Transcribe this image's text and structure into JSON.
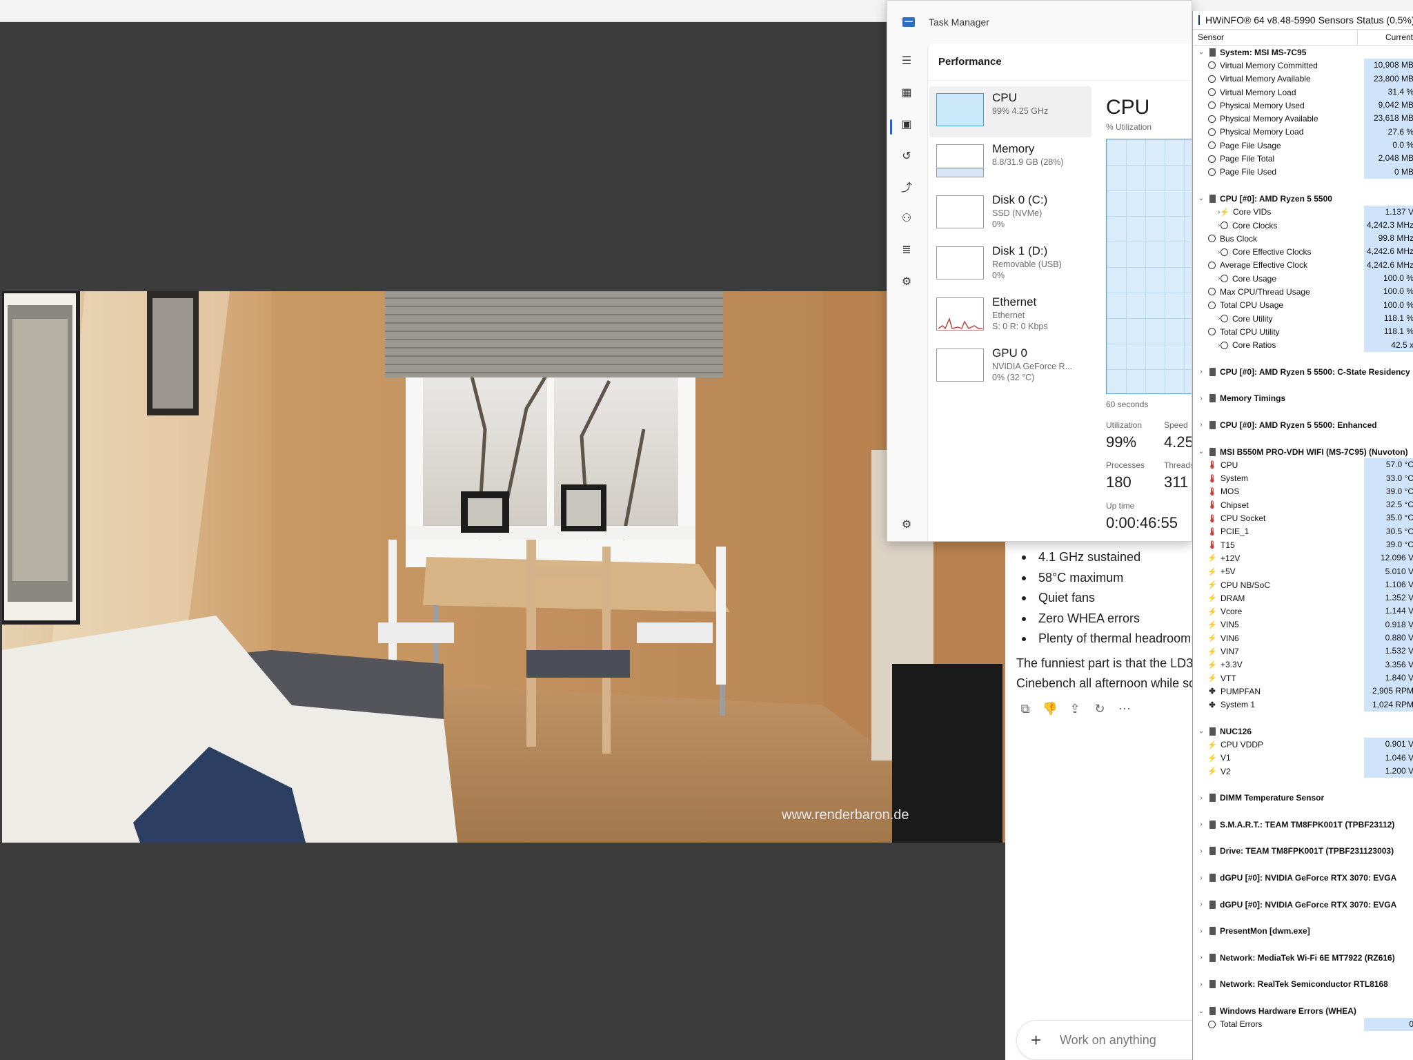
{
  "chat": {
    "bullets": [
      "4.1 GHz sustained",
      "58°C maximum",
      "Quiet fans",
      "Zero WHEA errors",
      "Plenty of thermal headroom"
    ],
    "paragraph_line1": "The funniest part is that the LD3",
    "paragraph_line2": "Cinebench all afternoon while sc",
    "composer_placeholder": "Work on anything"
  },
  "viewer": {
    "watermark": "www.renderbaron.de"
  },
  "task_manager": {
    "title": "Task Manager",
    "header": "Performance",
    "devices": [
      {
        "name": "CPU",
        "sub1": "99% 4.25 GHz",
        "sub2": "",
        "sub3": ""
      },
      {
        "name": "Memory",
        "sub1": "8.8/31.9 GB (28%)",
        "sub2": "",
        "sub3": ""
      },
      {
        "name": "Disk 0 (C:)",
        "sub1": "SSD (NVMe)",
        "sub2": "0%",
        "sub3": ""
      },
      {
        "name": "Disk 1 (D:)",
        "sub1": "Removable (USB)",
        "sub2": "0%",
        "sub3": ""
      },
      {
        "name": "Ethernet",
        "sub1": "Ethernet",
        "sub2": "S: 0 R: 0 Kbps",
        "sub3": ""
      },
      {
        "name": "GPU 0",
        "sub1": "NVIDIA GeForce R...",
        "sub2": "0% (32 °C)",
        "sub3": ""
      }
    ],
    "detail": {
      "title": "CPU",
      "subtitle": "% Utilization",
      "graph_span": "60 seconds",
      "utilization_label": "Utilization",
      "utilization_value": "99%",
      "speed_label": "Speed",
      "speed_value": "4.25",
      "processes_label": "Processes",
      "processes_value": "180",
      "threads_label": "Threads",
      "threads_value": "311",
      "uptime_label": "Up time",
      "uptime_value": "0:00:46:55"
    },
    "rail_icons": [
      "hamburger-icon",
      "processes-icon",
      "performance-icon",
      "app-history-icon",
      "startup-icon",
      "users-icon",
      "details-icon",
      "services-icon",
      "settings-icon"
    ]
  },
  "hwinfo": {
    "title": "HWiNFO® 64 v8.48-5990 Sensors Status (0.5%)",
    "col_sensor": "Sensor",
    "col_current": "Current",
    "rows": [
      {
        "t": "group",
        "caret": "v",
        "icon": "chip",
        "name": "System: MSI MS-7C95",
        "val": ""
      },
      {
        "t": "item",
        "caret": "",
        "icon": "clock",
        "name": "Virtual Memory Committed",
        "val": "10,908 MB"
      },
      {
        "t": "item",
        "caret": "",
        "icon": "clock",
        "name": "Virtual Memory Available",
        "val": "23,800 MB"
      },
      {
        "t": "item",
        "caret": "",
        "icon": "clock",
        "name": "Virtual Memory Load",
        "val": "31.4 %"
      },
      {
        "t": "item",
        "caret": "",
        "icon": "clock",
        "name": "Physical Memory Used",
        "val": "9,042 MB"
      },
      {
        "t": "item",
        "caret": "",
        "icon": "clock",
        "name": "Physical Memory Available",
        "val": "23,618 MB"
      },
      {
        "t": "item",
        "caret": "",
        "icon": "clock",
        "name": "Physical Memory Load",
        "val": "27.6 %"
      },
      {
        "t": "item",
        "caret": "",
        "icon": "clock",
        "name": "Page File Usage",
        "val": "0.0 %"
      },
      {
        "t": "item",
        "caret": "",
        "icon": "clock",
        "name": "Page File Total",
        "val": "2,048 MB"
      },
      {
        "t": "item",
        "caret": "",
        "icon": "clock",
        "name": "Page File Used",
        "val": "0 MB"
      },
      {
        "t": "spacer",
        "caret": "",
        "icon": "",
        "name": "",
        "val": ""
      },
      {
        "t": "group",
        "caret": "v",
        "icon": "chip",
        "name": "CPU [#0]: AMD Ryzen 5 5500",
        "val": ""
      },
      {
        "t": "child",
        "caret": ">",
        "icon": "volt",
        "name": "Core VIDs",
        "val": "1.137 V"
      },
      {
        "t": "child",
        "caret": ">",
        "icon": "clock",
        "name": "Core Clocks",
        "val": "4,242.3 MHz"
      },
      {
        "t": "item",
        "caret": "",
        "icon": "clock",
        "name": "Bus Clock",
        "val": "99.8 MHz"
      },
      {
        "t": "child",
        "caret": ">",
        "icon": "clock",
        "name": "Core Effective Clocks",
        "val": "4,242.6 MHz"
      },
      {
        "t": "item",
        "caret": "",
        "icon": "clock",
        "name": "Average Effective Clock",
        "val": "4,242.6 MHz"
      },
      {
        "t": "child",
        "caret": ">",
        "icon": "clock",
        "name": "Core Usage",
        "val": "100.0 %"
      },
      {
        "t": "item",
        "caret": "",
        "icon": "clock",
        "name": "Max CPU/Thread Usage",
        "val": "100.0 %"
      },
      {
        "t": "item",
        "caret": "",
        "icon": "clock",
        "name": "Total CPU Usage",
        "val": "100.0 %"
      },
      {
        "t": "child",
        "caret": ">",
        "icon": "clock",
        "name": "Core Utility",
        "val": "118.1 %"
      },
      {
        "t": "item",
        "caret": "",
        "icon": "clock",
        "name": "Total CPU Utility",
        "val": "118.1 %"
      },
      {
        "t": "child",
        "caret": ">",
        "icon": "clock",
        "name": "Core Ratios",
        "val": "42.5 x"
      },
      {
        "t": "spacer",
        "caret": "",
        "icon": "",
        "name": "",
        "val": ""
      },
      {
        "t": "group",
        "caret": ">",
        "icon": "chip",
        "name": "CPU [#0]: AMD Ryzen 5 5500: C-State Residency",
        "val": ""
      },
      {
        "t": "spacer",
        "caret": "",
        "icon": "",
        "name": "",
        "val": ""
      },
      {
        "t": "group",
        "caret": ">",
        "icon": "chip",
        "name": "Memory Timings",
        "val": ""
      },
      {
        "t": "spacer",
        "caret": "",
        "icon": "",
        "name": "",
        "val": ""
      },
      {
        "t": "group",
        "caret": ">",
        "icon": "chip",
        "name": "CPU [#0]: AMD Ryzen 5 5500: Enhanced",
        "val": ""
      },
      {
        "t": "spacer",
        "caret": "",
        "icon": "",
        "name": "",
        "val": ""
      },
      {
        "t": "group",
        "caret": "v",
        "icon": "chip",
        "name": "MSI B550M PRO-VDH WIFI (MS-7C95) (Nuvoton)",
        "val": ""
      },
      {
        "t": "item",
        "caret": "",
        "icon": "temp",
        "name": "CPU",
        "val": "57.0 °C"
      },
      {
        "t": "item",
        "caret": "",
        "icon": "temp",
        "name": "System",
        "val": "33.0 °C"
      },
      {
        "t": "item",
        "caret": "",
        "icon": "temp",
        "name": "MOS",
        "val": "39.0 °C"
      },
      {
        "t": "item",
        "caret": "",
        "icon": "temp",
        "name": "Chipset",
        "val": "32.5 °C"
      },
      {
        "t": "item",
        "caret": "",
        "icon": "temp",
        "name": "CPU Socket",
        "val": "35.0 °C"
      },
      {
        "t": "item",
        "caret": "",
        "icon": "temp",
        "name": "PCIE_1",
        "val": "30.5 °C"
      },
      {
        "t": "item",
        "caret": "",
        "icon": "temp",
        "name": "T15",
        "val": "39.0 °C"
      },
      {
        "t": "item",
        "caret": "",
        "icon": "volt",
        "name": "+12V",
        "val": "12.096 V"
      },
      {
        "t": "item",
        "caret": "",
        "icon": "volt",
        "name": "+5V",
        "val": "5.010 V"
      },
      {
        "t": "item",
        "caret": "",
        "icon": "volt",
        "name": "CPU NB/SoC",
        "val": "1.106 V"
      },
      {
        "t": "item",
        "caret": "",
        "icon": "volt",
        "name": "DRAM",
        "val": "1.352 V"
      },
      {
        "t": "item",
        "caret": "",
        "icon": "volt",
        "name": "Vcore",
        "val": "1.144 V"
      },
      {
        "t": "item",
        "caret": "",
        "icon": "volt",
        "name": "VIN5",
        "val": "0.918 V"
      },
      {
        "t": "item",
        "caret": "",
        "icon": "volt",
        "name": "VIN6",
        "val": "0.880 V"
      },
      {
        "t": "item",
        "caret": "",
        "icon": "volt",
        "name": "VIN7",
        "val": "1.532 V"
      },
      {
        "t": "item",
        "caret": "",
        "icon": "volt",
        "name": "+3.3V",
        "val": "3.356 V"
      },
      {
        "t": "item",
        "caret": "",
        "icon": "volt",
        "name": "VTT",
        "val": "1.840 V"
      },
      {
        "t": "item",
        "caret": "",
        "icon": "fan",
        "name": "PUMPFAN",
        "val": "2,905 RPM"
      },
      {
        "t": "item",
        "caret": "",
        "icon": "fan",
        "name": "System 1",
        "val": "1,024 RPM"
      },
      {
        "t": "spacer",
        "caret": "",
        "icon": "",
        "name": "",
        "val": ""
      },
      {
        "t": "group",
        "caret": "v",
        "icon": "chip",
        "name": "NUC126",
        "val": ""
      },
      {
        "t": "item",
        "caret": "",
        "icon": "volt",
        "name": "CPU VDDP",
        "val": "0.901 V"
      },
      {
        "t": "item",
        "caret": "",
        "icon": "volt",
        "name": "V1",
        "val": "1.046 V"
      },
      {
        "t": "item",
        "caret": "",
        "icon": "volt",
        "name": "V2",
        "val": "1.200 V"
      },
      {
        "t": "spacer",
        "caret": "",
        "icon": "",
        "name": "",
        "val": ""
      },
      {
        "t": "group",
        "caret": ">",
        "icon": "chip",
        "name": "DIMM Temperature Sensor",
        "val": ""
      },
      {
        "t": "spacer",
        "caret": "",
        "icon": "",
        "name": "",
        "val": ""
      },
      {
        "t": "group",
        "caret": ">",
        "icon": "chip",
        "name": "S.M.A.R.T.: TEAM TM8FPK001T (TPBF23112)",
        "val": ""
      },
      {
        "t": "spacer",
        "caret": "",
        "icon": "",
        "name": "",
        "val": ""
      },
      {
        "t": "group",
        "caret": ">",
        "icon": "chip",
        "name": "Drive: TEAM TM8FPK001T (TPBF231123003)",
        "val": ""
      },
      {
        "t": "spacer",
        "caret": "",
        "icon": "",
        "name": "",
        "val": ""
      },
      {
        "t": "group",
        "caret": ">",
        "icon": "chip",
        "name": "dGPU [#0]: NVIDIA GeForce RTX 3070: EVGA",
        "val": ""
      },
      {
        "t": "spacer",
        "caret": "",
        "icon": "",
        "name": "",
        "val": ""
      },
      {
        "t": "group",
        "caret": ">",
        "icon": "chip",
        "name": "dGPU [#0]: NVIDIA GeForce RTX 3070: EVGA",
        "val": ""
      },
      {
        "t": "spacer",
        "caret": "",
        "icon": "",
        "name": "",
        "val": ""
      },
      {
        "t": "group",
        "caret": ">",
        "icon": "chip",
        "name": "PresentMon [dwm.exe]",
        "val": ""
      },
      {
        "t": "spacer",
        "caret": "",
        "icon": "",
        "name": "",
        "val": ""
      },
      {
        "t": "group",
        "caret": ">",
        "icon": "chip",
        "name": "Network: MediaTek Wi-Fi 6E MT7922 (RZ616)",
        "val": ""
      },
      {
        "t": "spacer",
        "caret": "",
        "icon": "",
        "name": "",
        "val": ""
      },
      {
        "t": "group",
        "caret": ">",
        "icon": "chip",
        "name": "Network: RealTek Semiconductor RTL8168",
        "val": ""
      },
      {
        "t": "spacer",
        "caret": "",
        "icon": "",
        "name": "",
        "val": ""
      },
      {
        "t": "group",
        "caret": "v",
        "icon": "chip",
        "name": "Windows Hardware Errors (WHEA)",
        "val": ""
      },
      {
        "t": "item",
        "caret": "",
        "icon": "clock",
        "name": "Total Errors",
        "val": "0"
      }
    ]
  }
}
